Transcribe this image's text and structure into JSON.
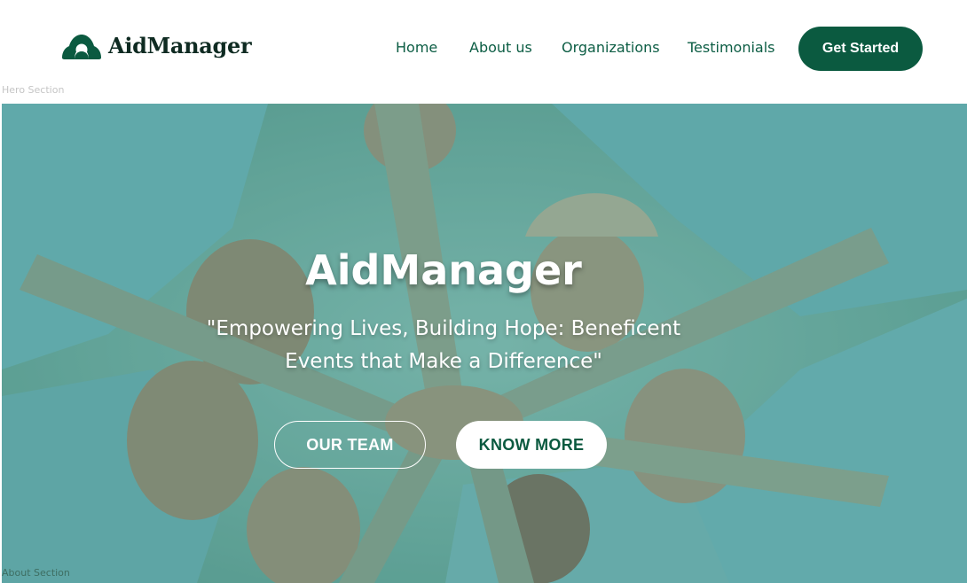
{
  "brand": {
    "name": "AidManager",
    "icon": "hands-logo-icon",
    "color": "#0b5a40"
  },
  "nav": {
    "home": "Home",
    "about": "About us",
    "organizations": "Organizations",
    "testimonials": "Testimonials",
    "cta": "Get Started"
  },
  "section_labels": {
    "hero": "Hero Section",
    "about": "About Section"
  },
  "hero": {
    "title": "AidManager",
    "tagline": "\"Empowering Lives, Building Hope: Beneficent Events that Make a Difference\"",
    "primary_button": "OUR TEAM",
    "secondary_button": "KNOW MORE",
    "image": "volunteers-hands-together-photo"
  },
  "colors": {
    "accent": "#0b5a40",
    "nav_text": "#0c5d44",
    "hero_overlay": "#7db3ab"
  }
}
